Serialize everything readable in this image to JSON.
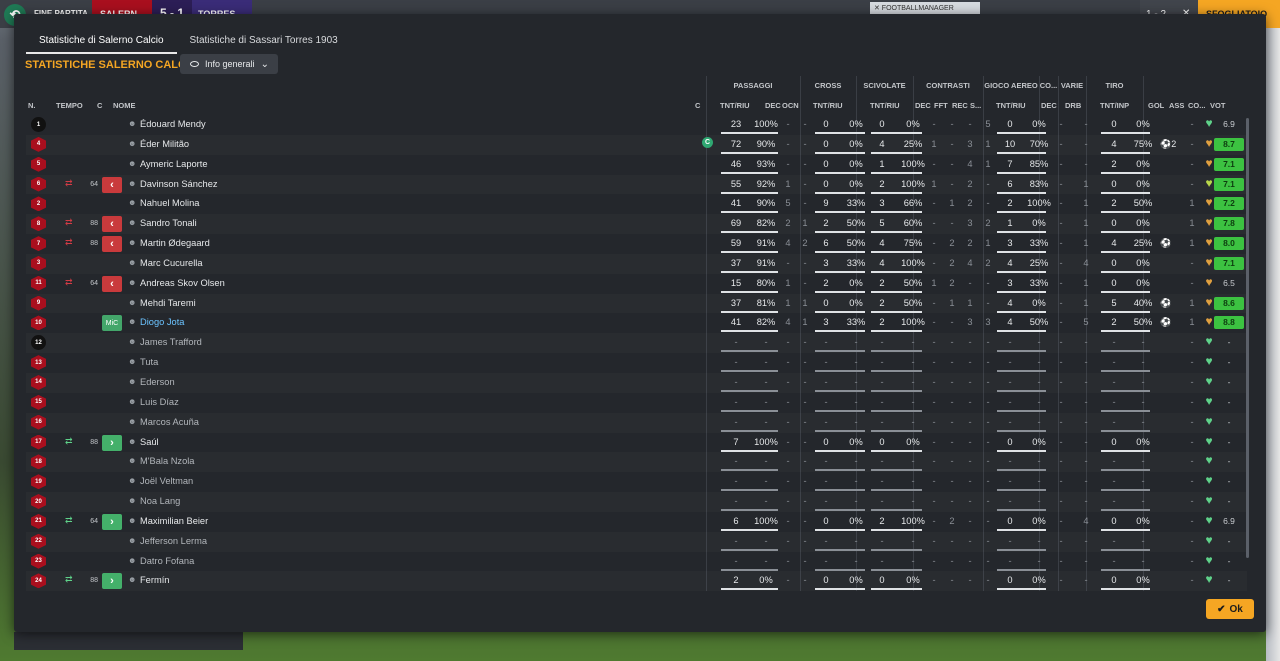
{
  "topbar": {
    "status": "FINE PARTITA",
    "home": "SALERN",
    "score": "5 - 1",
    "away": "TORRES",
    "ad": "✕ FOOTBALLMANAGER",
    "right_score": "1 - 2",
    "cta": "SFOGLIATOIO"
  },
  "tabs": [
    {
      "label": "Statistiche di Salerno Calcio"
    },
    {
      "label": "Statistiche di Sassari Torres 1903"
    }
  ],
  "section_title": "STATISTICHE SALERNO CALCIO",
  "dropdown_label": "Info generali",
  "groups": {
    "passaggi": "PASSAGGI",
    "cross": "CROSS",
    "scivolate": "SCIVOLATE",
    "contrasti": "CONTRASTI",
    "gioco_aereo": "GIOCO AEREO",
    "co": "CO...",
    "varie": "VARIE",
    "tiro": "TIRO"
  },
  "headers": {
    "n": "N.",
    "tempo": "TEMPO",
    "c": "C",
    "nome": "NOME",
    "c2": "C",
    "pass": "TNT/RIU",
    "dec": "DEC",
    "ocn": "OCN",
    "cross": "TNT/RIU",
    "sciv": "TNT/RIU",
    "cdec": "DEC",
    "fft": "FFT",
    "rec": "REC",
    "s": "S...",
    "aereo": "TNT/RIU",
    "codec": "DEC",
    "drb": "DRB",
    "tiro": "TNT/INP",
    "gol": "GOL",
    "ass": "ASS",
    "co": "CO...",
    "vot": "VOT"
  },
  "players": [
    {
      "n": "1",
      "gk": true,
      "mins": "",
      "sub": "",
      "name": "Édouard Mendy",
      "pa": "23",
      "pp": "100%",
      "dec": "-",
      "ocn": "-",
      "ca": "0",
      "cp": "0%",
      "sa": "0",
      "sp": "0%",
      "cd": "-",
      "fft": "-",
      "rec": "-",
      "s": "5",
      "aa": "0",
      "ap": "0%",
      "od": "-",
      "drb": "-",
      "ta": "0",
      "tp": "0%",
      "gol": "",
      "ass": "-",
      "heart": "#5fd38a",
      "vot": "6.9",
      "vg": false
    },
    {
      "n": "4",
      "mins": "",
      "sub": "",
      "name": "Éder Militão",
      "capt": "C",
      "pa": "72",
      "pp": "90%",
      "dec": "-",
      "ocn": "-",
      "ca": "0",
      "cp": "0%",
      "sa": "4",
      "sp": "25%",
      "cd": "1",
      "fft": "-",
      "rec": "3",
      "s": "1",
      "aa": "10",
      "ap": "70%",
      "od": "-",
      "drb": "-",
      "ta": "4",
      "tp": "75%",
      "gol": "⚽2",
      "ass": "-",
      "heart": "#e0a040",
      "vot": "8.7",
      "vg": true
    },
    {
      "n": "5",
      "mins": "",
      "sub": "",
      "name": "Aymeric Laporte",
      "pa": "46",
      "pp": "93%",
      "dec": "-",
      "ocn": "-",
      "ca": "0",
      "cp": "0%",
      "sa": "1",
      "sp": "100%",
      "cd": "-",
      "fft": "-",
      "rec": "4",
      "s": "1",
      "aa": "7",
      "ap": "85%",
      "od": "-",
      "drb": "-",
      "ta": "2",
      "tp": "0%",
      "gol": "",
      "ass": "-",
      "heart": "#e0a040",
      "vot": "7.1",
      "vg": true
    },
    {
      "n": "6",
      "out": true,
      "mins": "64",
      "sub": "off",
      "name": "Davinson Sánchez",
      "pa": "55",
      "pp": "92%",
      "dec": "1",
      "ocn": "-",
      "ca": "0",
      "cp": "0%",
      "sa": "2",
      "sp": "100%",
      "cd": "1",
      "fft": "-",
      "rec": "2",
      "s": "-",
      "aa": "6",
      "ap": "83%",
      "od": "-",
      "drb": "1",
      "ta": "0",
      "tp": "0%",
      "gol": "",
      "ass": "-",
      "heart": "#b9d84a",
      "vot": "7.1",
      "vg": true
    },
    {
      "n": "2",
      "mins": "",
      "sub": "",
      "name": "Nahuel Molina",
      "pa": "41",
      "pp": "90%",
      "dec": "5",
      "ocn": "-",
      "ca": "9",
      "cp": "33%",
      "sa": "3",
      "sp": "66%",
      "cd": "-",
      "fft": "1",
      "rec": "2",
      "s": "-",
      "aa": "2",
      "ap": "100%",
      "od": "-",
      "drb": "1",
      "ta": "2",
      "tp": "50%",
      "gol": "",
      "ass": "1",
      "heart": "#e0a040",
      "vot": "7.2",
      "vg": true
    },
    {
      "n": "8",
      "out": true,
      "mins": "88",
      "sub": "off",
      "name": "Sandro Tonali",
      "pa": "69",
      "pp": "82%",
      "dec": "2",
      "ocn": "1",
      "ca": "2",
      "cp": "50%",
      "sa": "5",
      "sp": "60%",
      "cd": "-",
      "fft": "-",
      "rec": "3",
      "s": "2",
      "aa": "1",
      "ap": "0%",
      "od": "-",
      "drb": "1",
      "ta": "0",
      "tp": "0%",
      "gol": "",
      "ass": "1",
      "heart": "#e0a040",
      "vot": "7.8",
      "vg": true
    },
    {
      "n": "7",
      "out": true,
      "mins": "88",
      "sub": "off",
      "name": "Martin Ødegaard",
      "pa": "59",
      "pp": "91%",
      "dec": "4",
      "ocn": "2",
      "ca": "6",
      "cp": "50%",
      "sa": "4",
      "sp": "75%",
      "cd": "-",
      "fft": "2",
      "rec": "2",
      "s": "1",
      "aa": "3",
      "ap": "33%",
      "od": "-",
      "drb": "1",
      "ta": "4",
      "tp": "25%",
      "gol": "⚽",
      "ass": "1",
      "heart": "#e0a040",
      "vot": "8.0",
      "vg": true
    },
    {
      "n": "3",
      "mins": "",
      "sub": "",
      "name": "Marc Cucurella",
      "pa": "37",
      "pp": "91%",
      "dec": "-",
      "ocn": "-",
      "ca": "3",
      "cp": "33%",
      "sa": "4",
      "sp": "100%",
      "cd": "-",
      "fft": "2",
      "rec": "4",
      "s": "2",
      "aa": "4",
      "ap": "25%",
      "od": "-",
      "drb": "4",
      "ta": "0",
      "tp": "0%",
      "gol": "",
      "ass": "-",
      "heart": "#e0a040",
      "vot": "7.1",
      "vg": true
    },
    {
      "n": "11",
      "out": true,
      "mins": "64",
      "sub": "off",
      "name": "Andreas Skov Olsen",
      "pa": "15",
      "pp": "80%",
      "dec": "1",
      "ocn": "-",
      "ca": "2",
      "cp": "0%",
      "sa": "2",
      "sp": "50%",
      "cd": "1",
      "fft": "2",
      "rec": "-",
      "s": "-",
      "aa": "3",
      "ap": "33%",
      "od": "-",
      "drb": "1",
      "ta": "0",
      "tp": "0%",
      "gol": "",
      "ass": "-",
      "heart": "#e0a040",
      "vot": "6.5",
      "vg": false
    },
    {
      "n": "9",
      "mins": "",
      "sub": "",
      "name": "Mehdi Taremi",
      "pa": "37",
      "pp": "81%",
      "dec": "1",
      "ocn": "1",
      "ca": "0",
      "cp": "0%",
      "sa": "2",
      "sp": "50%",
      "cd": "-",
      "fft": "1",
      "rec": "1",
      "s": "-",
      "aa": "4",
      "ap": "0%",
      "od": "-",
      "drb": "1",
      "ta": "5",
      "tp": "40%",
      "gol": "⚽",
      "ass": "1",
      "heart": "#e0a040",
      "vot": "8.6",
      "vg": true
    },
    {
      "n": "10",
      "mins": "",
      "sub": "mic",
      "mic": "MiC",
      "name": "Diogo Jota",
      "hl": true,
      "pa": "41",
      "pp": "82%",
      "dec": "4",
      "ocn": "1",
      "ca": "3",
      "cp": "33%",
      "sa": "2",
      "sp": "100%",
      "cd": "-",
      "fft": "-",
      "rec": "3",
      "s": "3",
      "aa": "4",
      "ap": "50%",
      "od": "-",
      "drb": "5",
      "ta": "2",
      "tp": "50%",
      "gol": "⚽",
      "ass": "1",
      "heart": "#e0a040",
      "vot": "8.8",
      "vg": true
    },
    {
      "n": "12",
      "gk": true,
      "mins": "",
      "sub": "",
      "name": "James Trafford",
      "empty": true,
      "dim": true,
      "heart": "#5fd38a",
      "vot": "-"
    },
    {
      "n": "13",
      "mins": "",
      "sub": "",
      "name": "Tuta",
      "empty": true,
      "dim": true,
      "heart": "#5fd38a",
      "vot": "-"
    },
    {
      "n": "14",
      "mins": "",
      "sub": "",
      "name": "Ederson",
      "empty": true,
      "dim": true,
      "heart": "#5fd38a",
      "vot": "-"
    },
    {
      "n": "15",
      "mins": "",
      "sub": "",
      "name": "Luis Díaz",
      "empty": true,
      "dim": true,
      "heart": "#5fd38a",
      "vot": "-"
    },
    {
      "n": "16",
      "mins": "",
      "sub": "",
      "name": "Marcos Acuña",
      "empty": true,
      "dim": true,
      "heart": "#5fd38a",
      "vot": "-"
    },
    {
      "n": "17",
      "in": true,
      "mins": "88",
      "sub": "on",
      "name": "Saúl",
      "pa": "7",
      "pp": "100%",
      "dec": "-",
      "ocn": "-",
      "ca": "0",
      "cp": "0%",
      "sa": "0",
      "sp": "0%",
      "cd": "-",
      "fft": "-",
      "rec": "-",
      "s": "-",
      "aa": "0",
      "ap": "0%",
      "od": "-",
      "drb": "-",
      "ta": "0",
      "tp": "0%",
      "gol": "",
      "ass": "-",
      "heart": "#5fd38a",
      "vot": "-",
      "vg": false
    },
    {
      "n": "18",
      "mins": "",
      "sub": "",
      "name": "M'Bala Nzola",
      "empty": true,
      "dim": true,
      "heart": "#5fd38a",
      "vot": "-"
    },
    {
      "n": "19",
      "mins": "",
      "sub": "",
      "name": "Joël Veltman",
      "empty": true,
      "dim": true,
      "heart": "#5fd38a",
      "vot": "-"
    },
    {
      "n": "20",
      "mins": "",
      "sub": "",
      "name": "Noa Lang",
      "empty": true,
      "dim": true,
      "heart": "#5fd38a",
      "vot": "-"
    },
    {
      "n": "21",
      "in": true,
      "mins": "64",
      "sub": "on",
      "name": "Maximilian Beier",
      "pa": "6",
      "pp": "100%",
      "dec": "-",
      "ocn": "-",
      "ca": "0",
      "cp": "0%",
      "sa": "2",
      "sp": "100%",
      "cd": "-",
      "fft": "2",
      "rec": "-",
      "s": "-",
      "aa": "0",
      "ap": "0%",
      "od": "-",
      "drb": "4",
      "ta": "0",
      "tp": "0%",
      "gol": "",
      "ass": "-",
      "heart": "#5fd38a",
      "vot": "6.9",
      "vg": false
    },
    {
      "n": "22",
      "mins": "",
      "sub": "",
      "name": "Jefferson Lerma",
      "empty": true,
      "dim": true,
      "heart": "#5fd38a",
      "vot": "-"
    },
    {
      "n": "23",
      "mins": "",
      "sub": "",
      "name": "Datro Fofana",
      "empty": true,
      "dim": true,
      "heart": "#5fd38a",
      "vot": "-"
    },
    {
      "n": "24",
      "in": true,
      "mins": "88",
      "sub": "on",
      "name": "Fermín",
      "pa": "2",
      "pp": "0%",
      "dec": "-",
      "ocn": "-",
      "ca": "0",
      "cp": "0%",
      "sa": "0",
      "sp": "0%",
      "cd": "-",
      "fft": "-",
      "rec": "-",
      "s": "-",
      "aa": "0",
      "ap": "0%",
      "od": "-",
      "drb": "-",
      "ta": "0",
      "tp": "0%",
      "gol": "",
      "ass": "-",
      "heart": "#5fd38a",
      "vot": "-",
      "vg": false
    }
  ],
  "ok_label": "Ok",
  "colors": {
    "accent": "#f5a623",
    "rating_green": "#3cc241",
    "home_red": "#a90f1e"
  }
}
